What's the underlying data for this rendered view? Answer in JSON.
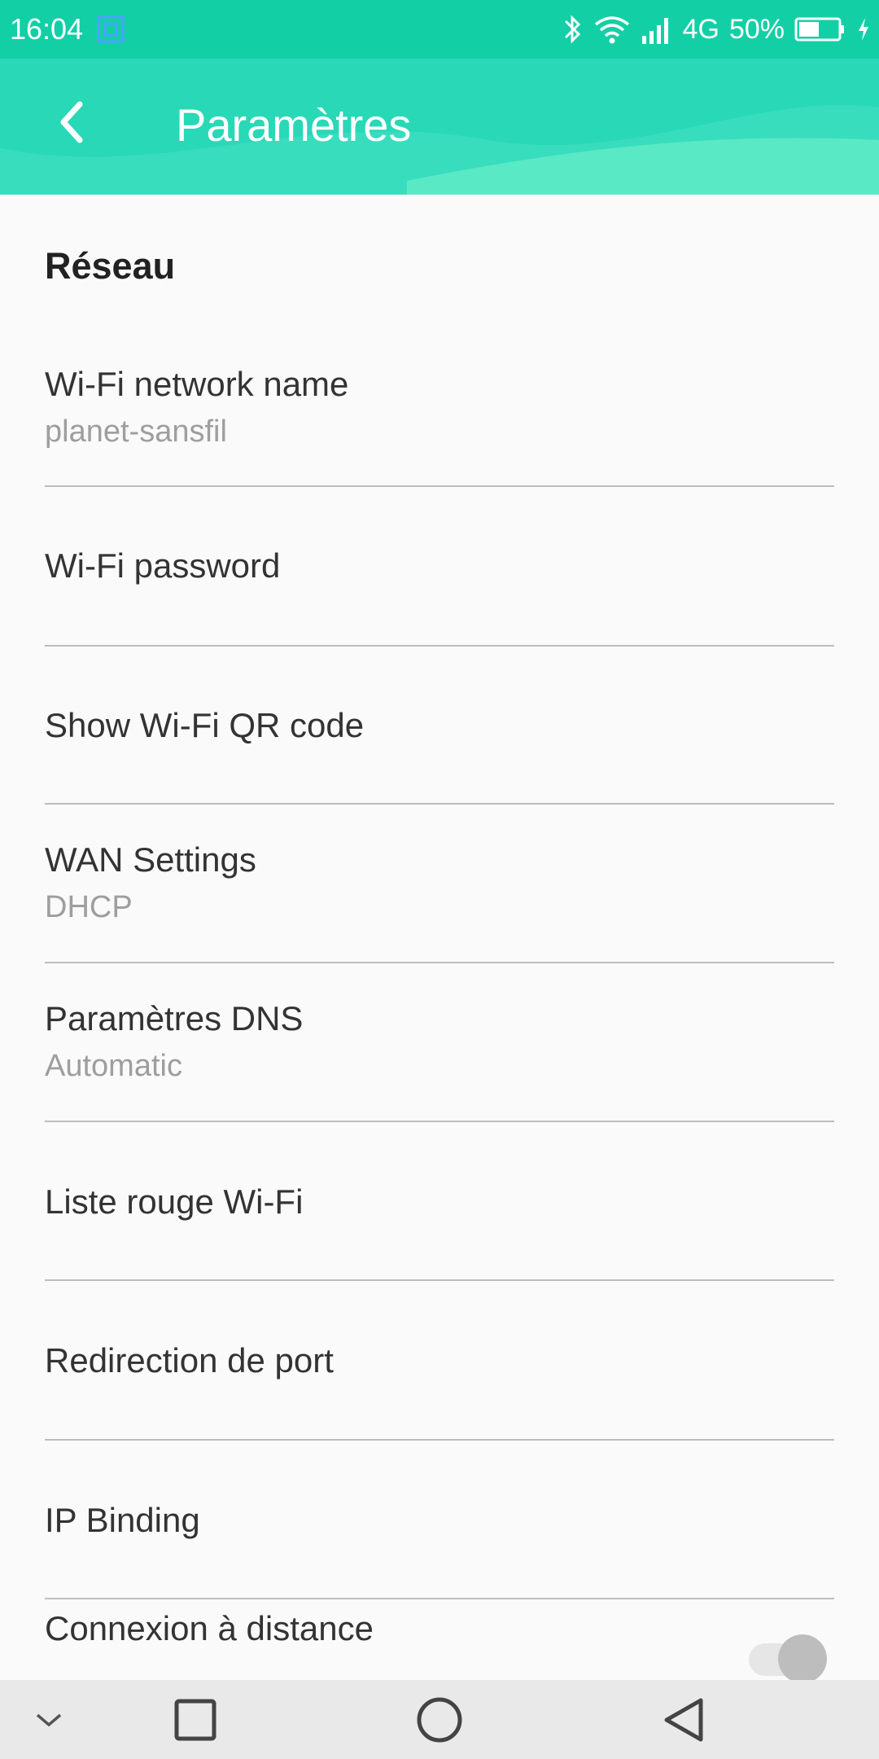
{
  "status_bar": {
    "time": "16:04",
    "network": "4G",
    "battery": "50%",
    "icons": [
      "screenshot-icon",
      "bluetooth-icon",
      "wifi-icon",
      "signal-icon",
      "battery-icon",
      "charging-icon"
    ]
  },
  "header": {
    "title": "Paramètres",
    "back_icon": "chevron-left-icon",
    "accent_color": "#13cfa6"
  },
  "section": {
    "title": "Réseau"
  },
  "items": [
    {
      "title": "Wi-Fi network name",
      "subtitle": "planet-sansfil"
    },
    {
      "title": "Wi-Fi password"
    },
    {
      "title": "Show Wi-Fi QR code"
    },
    {
      "title": "WAN Settings",
      "subtitle": "DHCP"
    },
    {
      "title": "Paramètres DNS",
      "subtitle": "Automatic"
    },
    {
      "title": "Liste rouge Wi-Fi"
    },
    {
      "title": "Redirection de port"
    },
    {
      "title": "IP Binding"
    }
  ],
  "remote": {
    "title": "Connexion à distance",
    "toggle_on": false
  },
  "nav_bar": {
    "icons": [
      "chevron-down-icon",
      "square-recents-icon",
      "circle-home-icon",
      "triangle-back-icon"
    ]
  }
}
